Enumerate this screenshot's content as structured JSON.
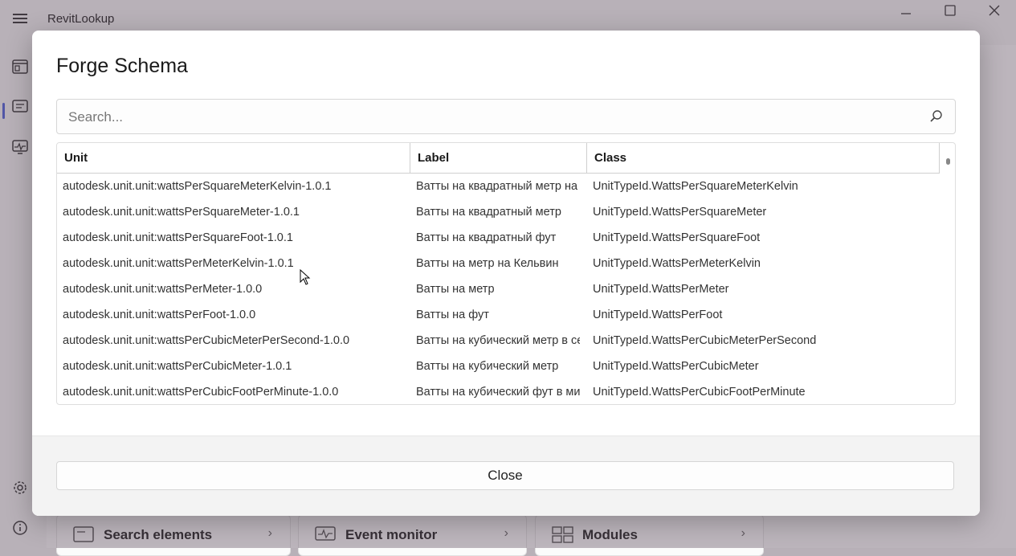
{
  "app": {
    "title": "RevitLookup",
    "window_controls": [
      "minimize",
      "maximize",
      "close"
    ]
  },
  "bottom_cards": [
    {
      "label": "Search elements",
      "icon": "search-elements-icon"
    },
    {
      "label": "Event monitor",
      "icon": "event-monitor-icon"
    },
    {
      "label": "Modules",
      "icon": "modules-icon"
    }
  ],
  "dialog": {
    "title": "Forge Schema",
    "search": {
      "placeholder": "Search...",
      "value": ""
    },
    "columns": [
      "Unit",
      "Label",
      "Class"
    ],
    "rows": [
      {
        "unit": "autodesk.unit.unit:wattsPerSquareMeterKelvin-1.0.1",
        "label": "Ватты на квадратный метр на Кельвин",
        "class": "UnitTypeId.WattsPerSquareMeterKelvin"
      },
      {
        "unit": "autodesk.unit.unit:wattsPerSquareMeter-1.0.1",
        "label": "Ватты на квадратный метр",
        "class": "UnitTypeId.WattsPerSquareMeter"
      },
      {
        "unit": "autodesk.unit.unit:wattsPerSquareFoot-1.0.1",
        "label": "Ватты на квадратный фут",
        "class": "UnitTypeId.WattsPerSquareFoot"
      },
      {
        "unit": "autodesk.unit.unit:wattsPerMeterKelvin-1.0.1",
        "label": "Ватты на метр на Кельвин",
        "class": "UnitTypeId.WattsPerMeterKelvin"
      },
      {
        "unit": "autodesk.unit.unit:wattsPerMeter-1.0.0",
        "label": "Ватты на метр",
        "class": "UnitTypeId.WattsPerMeter"
      },
      {
        "unit": "autodesk.unit.unit:wattsPerFoot-1.0.0",
        "label": "Ватты на фут",
        "class": "UnitTypeId.WattsPerFoot"
      },
      {
        "unit": "autodesk.unit.unit:wattsPerCubicMeterPerSecond-1.0.0",
        "label": "Ватты на кубический метр в секунду",
        "class": "UnitTypeId.WattsPerCubicMeterPerSecond"
      },
      {
        "unit": "autodesk.unit.unit:wattsPerCubicMeter-1.0.1",
        "label": "Ватты на кубический метр",
        "class": "UnitTypeId.WattsPerCubicMeter"
      },
      {
        "unit": "autodesk.unit.unit:wattsPerCubicFootPerMinute-1.0.0",
        "label": "Ватты на кубический фут в минуту",
        "class": "UnitTypeId.WattsPerCubicFootPerMinute"
      }
    ],
    "close_label": "Close"
  }
}
